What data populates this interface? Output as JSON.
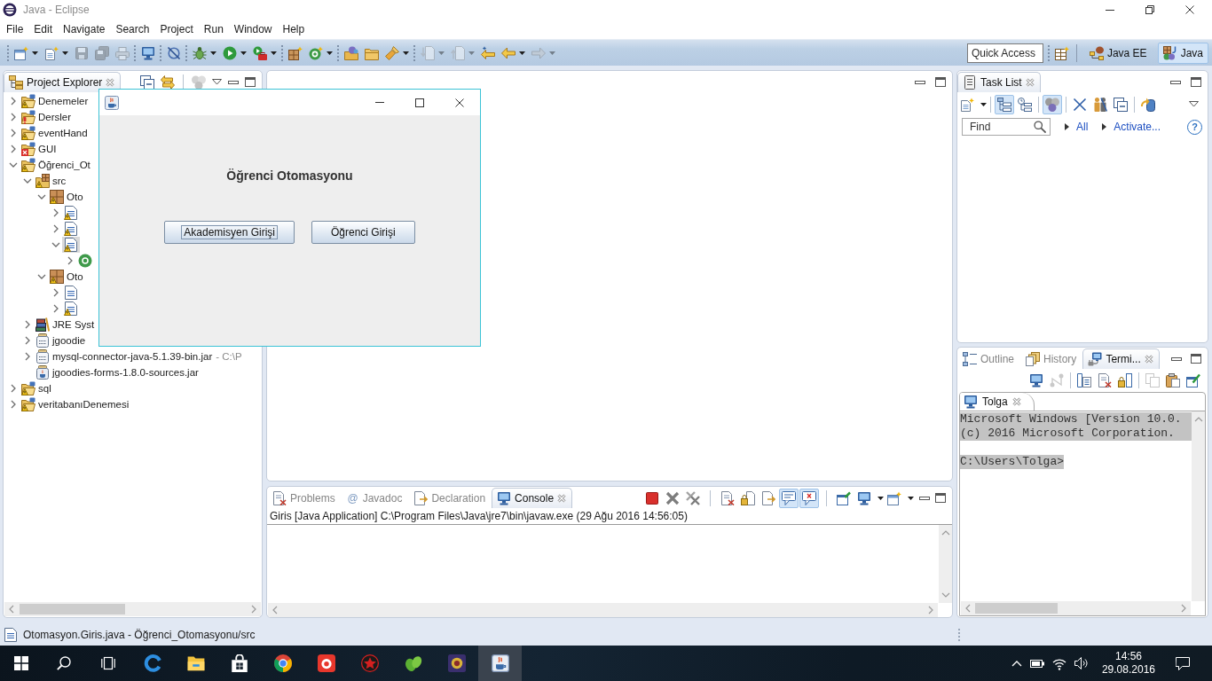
{
  "window": {
    "title": "Java - Eclipse"
  },
  "menu": [
    "File",
    "Edit",
    "Navigate",
    "Search",
    "Project",
    "Run",
    "Window",
    "Help"
  ],
  "toolbar": {
    "groups": [
      [
        {
          "disabled": false,
          "menu": true
        },
        {
          "disabled": false,
          "menu": true
        },
        {
          "disabled": true,
          "menu": false
        },
        {
          "disabled": true,
          "menu": false
        },
        {
          "disabled": true,
          "menu": false
        }
      ],
      [
        {
          "disabled": false,
          "menu": false
        }
      ],
      [
        {
          "disabled": false,
          "menu": false
        }
      ],
      [
        {
          "disabled": false,
          "menu": true
        },
        {
          "disabled": false,
          "menu": true
        },
        {
          "disabled": false,
          "menu": true
        }
      ],
      [
        {
          "disabled": false,
          "menu": false
        },
        {
          "disabled": false,
          "menu": true
        }
      ],
      [
        {
          "disabled": false,
          "menu": false
        },
        {
          "disabled": false,
          "menu": false
        },
        {
          "disabled": false,
          "menu": true
        }
      ],
      [
        {
          "disabled": true,
          "menu": true
        },
        {
          "disabled": true,
          "menu": true
        },
        {
          "disabled": false,
          "menu": false
        },
        {
          "disabled": false,
          "menu": true
        },
        {
          "disabled": true,
          "menu": true
        }
      ]
    ],
    "quick_access": {
      "placeholder": "Quick Access"
    },
    "perspectives": [
      {
        "label": "Java EE",
        "selected": false
      },
      {
        "label": "Java",
        "selected": true
      }
    ]
  },
  "project_explorer": {
    "tabs": [
      {
        "label": "Project Explorer",
        "selected": true
      }
    ],
    "toolbar": [
      [
        {
          "disabled": false
        },
        {
          "disabled": false
        }
      ],
      [
        {
          "disabled": true
        }
      ]
    ],
    "tree": [
      {
        "label": "Denemeler",
        "kind": "project",
        "badge": {
          "kind": "warning"
        },
        "expanded": false,
        "selected": false
      },
      {
        "label": "Dersler",
        "kind": "project",
        "badge": {
          "kind": "exclamation"
        },
        "expanded": false,
        "selected": false
      },
      {
        "label": "eventHand",
        "kind": "project",
        "badge": {
          "kind": "warning"
        },
        "expanded": false,
        "selected": false
      },
      {
        "label": "GUI",
        "kind": "project",
        "badge": {
          "kind": "error"
        },
        "expanded": false,
        "selected": false
      },
      {
        "label": "Öğrenci_Ot",
        "kind": "project",
        "badge": {
          "kind": "warning"
        },
        "expanded": true,
        "selected": false,
        "children": [
          {
            "label": "src",
            "kind": "source_folder",
            "badge": {
              "kind": "warning"
            },
            "expanded": true,
            "selected": false,
            "children": [
              {
                "label": "Oto",
                "kind": "package",
                "badge": {
                  "kind": "warning"
                },
                "expanded": true,
                "selected": false,
                "children": [
                  {
                    "kind": "java_file",
                    "badge": {
                      "kind": "warning"
                    },
                    "expanded": false,
                    "selected": false
                  },
                  {
                    "kind": "java_file",
                    "badge": {
                      "kind": "warning"
                    },
                    "expanded": false,
                    "selected": false
                  },
                  {
                    "kind": "java_file",
                    "badge": {
                      "kind": "warning"
                    },
                    "expanded": true,
                    "selected": true,
                    "children": [
                      {
                        "kind": "class",
                        "expanded": false,
                        "selected": false
                      }
                    ]
                  }
                ]
              },
              {
                "label": "Oto",
                "kind": "package",
                "badge": {
                  "kind": "warning"
                },
                "expanded": true,
                "selected": false,
                "children": [
                  {
                    "kind": "java_file",
                    "expanded": false,
                    "selected": false
                  },
                  {
                    "kind": "java_file",
                    "badge": {
                      "kind": "warning"
                    },
                    "expanded": false,
                    "selected": false
                  }
                ]
              }
            ]
          },
          {
            "label": "JRE Syst",
            "kind": "library",
            "expanded": false,
            "selected": false
          },
          {
            "label": "jgoodie",
            "kind": "jar",
            "expanded": false,
            "selected": false
          },
          {
            "label": "mysql-connector-java-5.1.39-bin.jar",
            "detail": "- C:\\P",
            "kind": "jar",
            "expanded": false,
            "selected": false
          },
          {
            "label": "jgoodies-forms-1.8.0-sources.jar",
            "kind": "source_jar",
            "selected": false
          }
        ]
      },
      {
        "label": "sql",
        "kind": "project",
        "badge": {
          "kind": "warning"
        },
        "expanded": false,
        "selected": false
      },
      {
        "label": "veritabanıDenemesi",
        "kind": "project",
        "badge": {
          "kind": "warning"
        },
        "expanded": false,
        "selected": false
      }
    ]
  },
  "dialog": {
    "heading": "Öğrenci Otomasyonu",
    "buttons": [
      {
        "label": "Akademisyen Girişi",
        "focused": true
      },
      {
        "label": "Öğrenci Girişi",
        "focused": false
      }
    ]
  },
  "console_panel": {
    "tabs": [
      {
        "label": "Problems",
        "selected": false
      },
      {
        "label": "Javadoc",
        "glyph": "@",
        "selected": false
      },
      {
        "label": "Declaration",
        "selected": false
      },
      {
        "label": "Console",
        "selected": true
      }
    ],
    "toolbar": [
      [
        {
          "pressed": false,
          "menu": false
        },
        {
          "pressed": false,
          "menu": false
        },
        {
          "pressed": false,
          "menu": false
        }
      ],
      [
        {
          "pressed": false,
          "menu": false
        },
        {
          "pressed": false,
          "menu": false
        },
        {
          "pressed": false,
          "menu": false
        },
        {
          "pressed": true,
          "menu": false
        },
        {
          "pressed": true,
          "menu": false
        }
      ],
      [
        {
          "pressed": false,
          "menu": false
        },
        {
          "pressed": false,
          "menu": true
        },
        {
          "pressed": false,
          "menu": true
        }
      ]
    ],
    "launch": "Giris [Java Application] C:\\Program Files\\Java\\jre7\\bin\\javaw.exe (29 Ağu 2016 14:56:05)"
  },
  "task_list": {
    "tabs": [
      {
        "label": "Task List",
        "selected": true
      }
    ],
    "toolbar": [
      [
        {
          "pressed": false,
          "menu": true
        }
      ],
      [
        {
          "pressed": true,
          "menu": false
        },
        {
          "pressed": false,
          "menu": false
        }
      ],
      [
        {
          "pressed": true,
          "menu": false
        }
      ],
      [
        {
          "pressed": false,
          "menu": false
        },
        {
          "pressed": false,
          "menu": false
        },
        {
          "pressed": false,
          "menu": false
        }
      ],
      [
        {
          "pressed": false,
          "menu": false
        }
      ]
    ],
    "find": {
      "placeholder": "Find"
    },
    "links": [
      "All",
      "Activate..."
    ],
    "help": "?"
  },
  "terminal_panel": {
    "tabs": [
      {
        "label": "Outline",
        "selected": false
      },
      {
        "label": "History",
        "selected": false
      },
      {
        "label": "Termi...",
        "selected": true
      }
    ],
    "toolbar": [
      [
        {
          "disabled": false
        },
        {
          "disabled": true
        }
      ],
      [
        {
          "disabled": false
        },
        {
          "disabled": false
        },
        {
          "disabled": false
        }
      ],
      [
        {
          "disabled": true
        },
        {
          "disabled": false
        },
        {
          "disabled": false
        }
      ]
    ],
    "sessions": [
      {
        "label": "Tolga",
        "selected": true
      }
    ],
    "lines": [
      {
        "kind": "output",
        "text": "Microsoft Windows [Version 10.0."
      },
      {
        "kind": "output",
        "text": "(c) 2016 Microsoft Corporation."
      },
      {
        "kind": "prompt",
        "text": "C:\\Users\\Tolga>"
      }
    ]
  },
  "status_bar": {
    "text": "Otomasyon.Giris.java - Öğrenci_Otomasyonu/src"
  },
  "taskbar": {
    "apps": [
      {
        "active": false
      },
      {
        "active": false
      },
      {
        "active": false
      },
      {
        "active": false
      },
      {
        "active": false
      },
      {
        "active": false
      },
      {
        "active": false
      },
      {
        "active": false
      },
      {
        "active": true
      }
    ],
    "time": "14:56",
    "date": "29.08.2016"
  }
}
